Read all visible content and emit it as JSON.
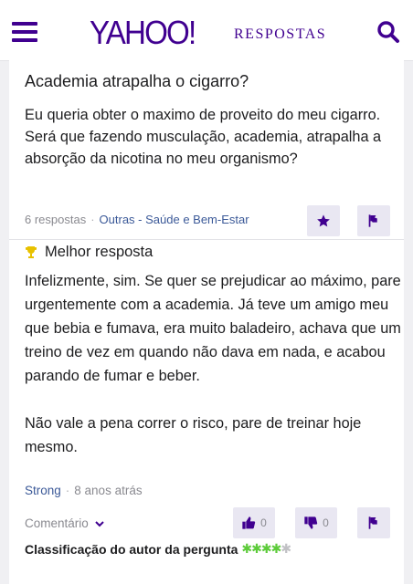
{
  "header": {
    "logo": "YAHOO!",
    "section": "RESPOSTAS",
    "brand_color": "#400090"
  },
  "question": {
    "title": "Academia atrapalha o cigarro?",
    "body": "Eu queria obter o maximo de proveito do meu cigarro. Será que fazendo musculação, academia, atrapalha a absorção da nicotina no meu organismo?",
    "answers_count": "6 respostas",
    "category": "Outras - Saúde e Bem-Estar"
  },
  "best_answer": {
    "label": "Melhor resposta",
    "paragraph_1": "Infelizmente, sim. Se quer se prejudicar ao máximo, pare urgentemente com a academia. Já teve um amigo meu que bebia e fumava, era muito baladeiro, achava que um treino de vez em quando não dava em nada, e acabou parando de fumar e beber.",
    "paragraph_2": "Não vale a pena correr o risco, pare de treinar hoje mesmo.",
    "author": "Strong",
    "time_ago": "8 anos atrás",
    "comment_label": "Comentário",
    "thumbs_up_count": "0",
    "thumbs_down_count": "0",
    "rating_label": "Classificação do autor da pergunta",
    "rating_stars": 4,
    "rating_max": 5
  },
  "icons": {
    "menu": "menu-icon",
    "search": "search-icon",
    "star": "star-icon",
    "flag": "flag-icon",
    "trophy": "trophy-icon",
    "thumbs_up": "thumbs-up-icon",
    "thumbs_down": "thumbs-down-icon",
    "chevron": "chevron-down-icon"
  },
  "colors": {
    "link": "#3b5998",
    "button_bg": "#e9e7f2",
    "star_on": "#5dcb3a",
    "trophy": "#e8c100"
  }
}
